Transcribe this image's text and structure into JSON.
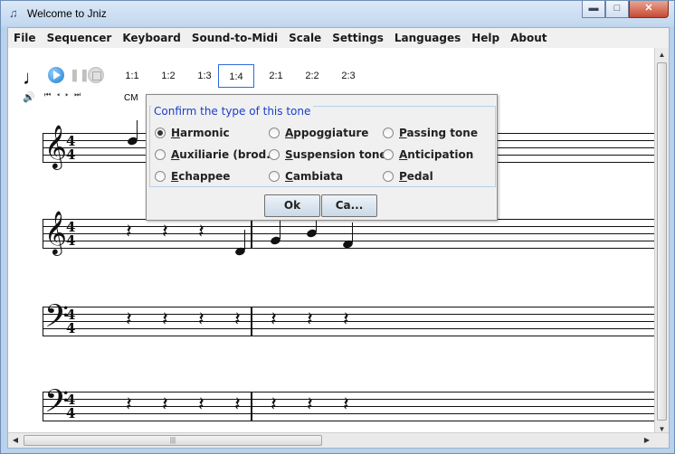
{
  "window": {
    "title": "Welcome to Jniz",
    "icon": "music-note-icon",
    "minimize_glyph": "▬",
    "maximize_glyph": "□",
    "close_glyph": "✕"
  },
  "menu": [
    "File",
    "Sequencer",
    "Keyboard",
    "Sound-to-Midi",
    "Scale",
    "Settings",
    "Languages",
    "Help",
    "About"
  ],
  "toolbar": {
    "ratios": [
      "1:1",
      "1:2",
      "1:3",
      "1:4",
      "2:1",
      "2:2",
      "2:3"
    ],
    "selected_ratio": "1:4",
    "cm_label": "CM",
    "transport_glyphs": "⏮ ◂ ▸ ⏭"
  },
  "score": {
    "staves": [
      {
        "clef": "𝄞",
        "time_top": "4",
        "time_bottom": "4"
      },
      {
        "clef": "𝄞",
        "time_top": "4",
        "time_bottom": "4"
      },
      {
        "clef": "𝄢",
        "time_top": "4",
        "time_bottom": "4"
      },
      {
        "clef": "𝄢",
        "time_top": "4",
        "time_bottom": "4"
      }
    ],
    "rest_glyph": "𝄽"
  },
  "dialog": {
    "group_title": "Confirm the type of this tone",
    "options": [
      "Harmonic",
      "Appoggiature",
      "Passing tone",
      "Auxiliarie (brod...",
      "Suspension tone",
      "Anticipation",
      "Echappee",
      "Cambiata",
      "Pedal"
    ],
    "selected": "Harmonic",
    "ok_label": "Ok",
    "cancel_label": "Ca..."
  },
  "scrollbars": {
    "up_arrow": "▲",
    "down_arrow": "▼",
    "left_arrow": "◀",
    "right_arrow": "▶",
    "grip": "|||"
  }
}
